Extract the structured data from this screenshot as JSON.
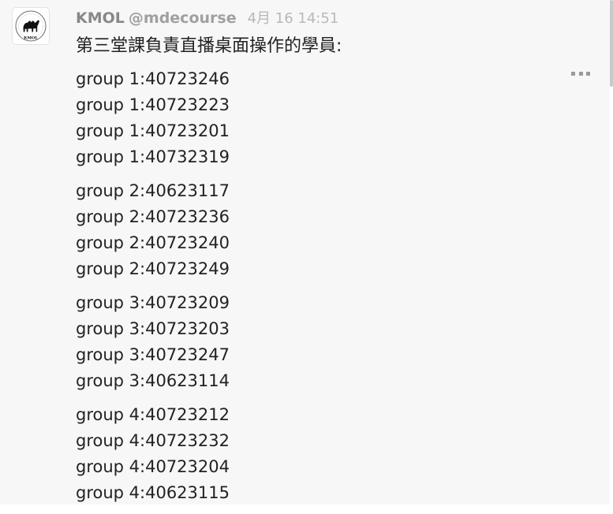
{
  "post": {
    "author_name": "KMOL",
    "author_handle": "@mdecourse",
    "timestamp": "4月 16 14:51",
    "avatar_text": "KMOL",
    "text": "第三堂課負責直播桌面操作的學員:"
  },
  "groups": [
    {
      "members": [
        "group 1:40723246",
        "group 1:40723223",
        "group 1:40723201",
        "group 1:40732319"
      ]
    },
    {
      "members": [
        "group 2:40623117",
        "group 2:40723236",
        "group 2:40723240",
        "group 2:40723249"
      ]
    },
    {
      "members": [
        "group 3:40723209",
        "group 3:40723203",
        "group 3:40723247",
        "group 3:40623114"
      ]
    },
    {
      "members": [
        "group 4:40723212",
        "group 4:40723232",
        "group 4:40723204",
        "group 4:40623115"
      ]
    }
  ],
  "icons": {
    "avatar": "camel-logo-icon",
    "more": "ellipsis-icon"
  }
}
